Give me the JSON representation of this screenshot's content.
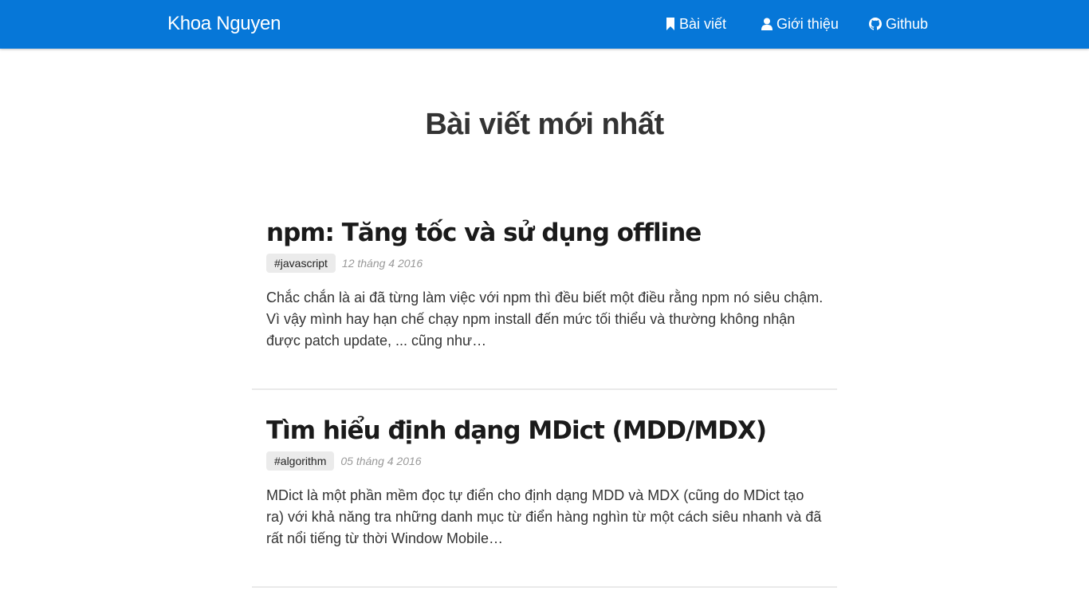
{
  "navbar": {
    "brand": "Khoa Nguyen",
    "links": [
      {
        "label": "Bài viết",
        "icon": "bookmark-icon"
      },
      {
        "label": "Giới thiệu",
        "icon": "user-icon"
      },
      {
        "label": "Github",
        "icon": "github-icon"
      }
    ]
  },
  "main": {
    "title": "Bài viết mới nhất",
    "posts": [
      {
        "title": "npm: Tăng tốc và sử dụng offline",
        "tag": "#javascript",
        "date": "12 tháng 4 2016",
        "excerpt": "Chắc chắn là ai đã từng làm việc với npm thì đều biết một điều rằng npm nó siêu chậm. Vì vậy mình hay hạn chế chạy npm install đến mức tối thiểu và thường không nhận được patch update, ... cũng như…"
      },
      {
        "title": "Tìm hiểu định dạng MDict (MDD/MDX)",
        "tag": "#algorithm",
        "date": "05 tháng 4 2016",
        "excerpt": "MDict là một phần mềm đọc tự điển cho định dạng MDD và MDX (cũng do MDict tạo ra) với khả năng tra những danh mục từ điển hàng nghìn từ một cách siêu nhanh và đã rất nổi tiếng từ thời Window Mobile…"
      }
    ]
  },
  "colors": {
    "navbar_bg": "#0677d8",
    "tag_bg": "#ebebeb",
    "date_text": "#999999"
  }
}
